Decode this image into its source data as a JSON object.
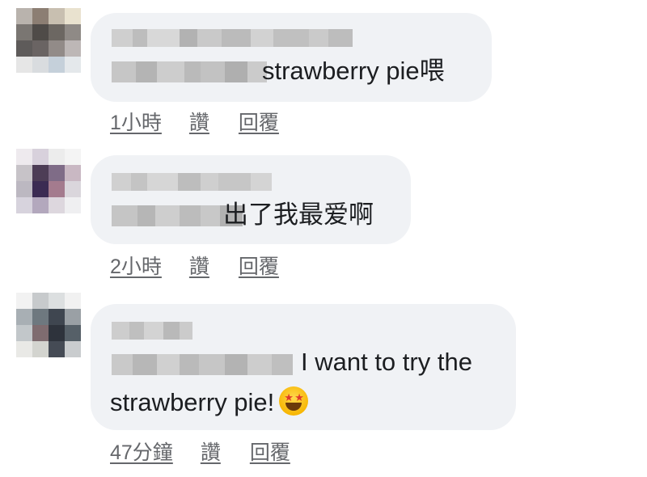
{
  "comments": [
    {
      "message": "strawberry pie喂",
      "time": "1小時",
      "like": "讚",
      "reply": "回覆"
    },
    {
      "message": "出了我最爱啊",
      "time": "2小時",
      "like": "讚",
      "reply": "回覆"
    },
    {
      "message_line1": "I want to try the",
      "message_line2": "strawberry pie!",
      "emoji_icon": "star-struck-emoji",
      "time": "47分鐘",
      "like": "讚",
      "reply": "回覆"
    }
  ],
  "colors": {
    "bubble": "#f0f2f5",
    "text": "#1c1e21",
    "meta": "#65676b"
  }
}
